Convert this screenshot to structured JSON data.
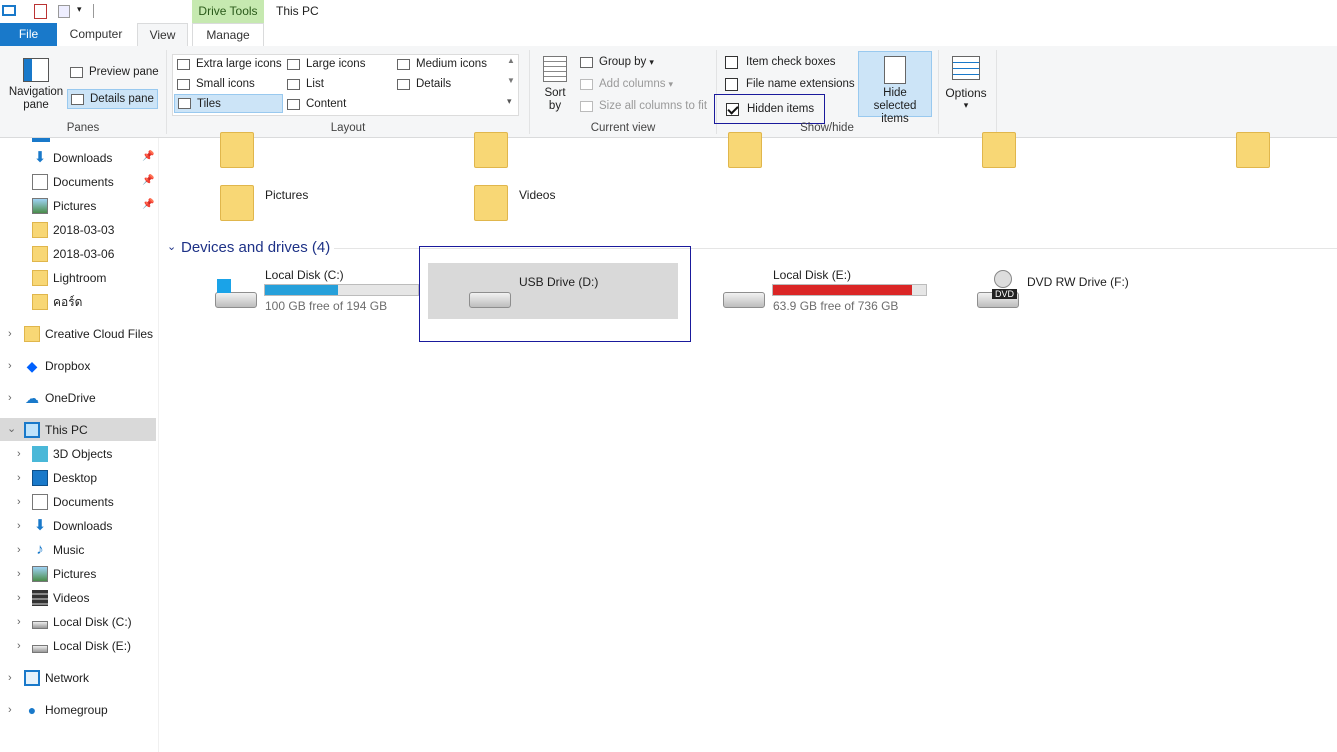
{
  "titlebar": {
    "contextual_tab": "Drive Tools",
    "window_title": "This PC"
  },
  "tabs": [
    {
      "label": "File"
    },
    {
      "label": "Computer"
    },
    {
      "label": "View"
    },
    {
      "label": "Manage"
    }
  ],
  "ribbon": {
    "panes": {
      "group": "Panes",
      "navigation_pane": "Navigation pane",
      "preview_pane": "Preview pane",
      "details_pane": "Details pane"
    },
    "layout": {
      "group": "Layout",
      "items": [
        "Extra large icons",
        "Large icons",
        "Medium icons",
        "Small icons",
        "List",
        "Details",
        "Tiles",
        "Content"
      ],
      "selected": "Tiles"
    },
    "current_view": {
      "group": "Current view",
      "sort_by": "Sort by",
      "group_by": "Group by",
      "add_columns": "Add columns",
      "size_columns": "Size all columns to fit"
    },
    "show_hide": {
      "group": "Show/hide",
      "item_check_boxes": "Item check boxes",
      "file_name_extensions": "File name extensions",
      "hidden_items": "Hidden items",
      "hidden_items_checked": true,
      "hide_selected_items": "Hide selected items"
    },
    "options": "Options"
  },
  "nav": {
    "quick_access": [
      {
        "label": "Downloads",
        "pinned": true
      },
      {
        "label": "Documents",
        "pinned": true
      },
      {
        "label": "Pictures",
        "pinned": true
      },
      {
        "label": "2018-03-03"
      },
      {
        "label": "2018-03-06"
      },
      {
        "label": "Lightroom"
      },
      {
        "label": "คอร์ด"
      }
    ],
    "roots": [
      {
        "label": "Creative Cloud Files"
      },
      {
        "label": "Dropbox"
      },
      {
        "label": "OneDrive"
      }
    ],
    "this_pc": "This PC",
    "this_pc_children": [
      "3D Objects",
      "Desktop",
      "Documents",
      "Downloads",
      "Music",
      "Pictures",
      "Videos",
      "Local Disk (C:)",
      "Local Disk (E:)"
    ],
    "network": "Network",
    "homegroup": "Homegroup"
  },
  "content": {
    "folders": [
      "Pictures",
      "Videos"
    ],
    "devices_header": "Devices and drives (4)",
    "drives": [
      {
        "name": "Local Disk (C:)",
        "free": "100 GB free of 194 GB",
        "used_fraction": 0.48,
        "bar_color": "#26a0da"
      },
      {
        "name": "USB Drive (D:)",
        "selected": true
      },
      {
        "name": "Local Disk (E:)",
        "free": "63.9 GB free of 736 GB",
        "used_fraction": 0.91,
        "bar_color": "#da2626"
      },
      {
        "name": "DVD RW Drive (F:)",
        "badge": "DVD"
      }
    ]
  },
  "colors": {
    "accent": "#1979ca",
    "selection": "#cce4f7",
    "highlight_box": "#1a1a9c",
    "link": "#1e3287"
  }
}
